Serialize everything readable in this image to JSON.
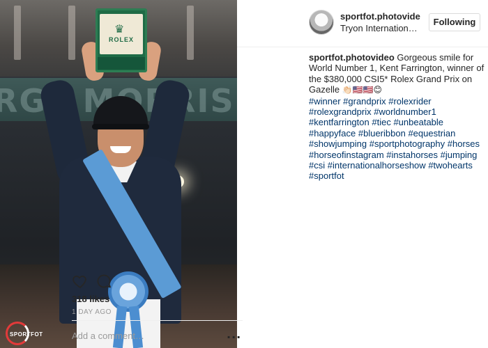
{
  "post": {
    "image_alt_brand": "ROLEX",
    "watermark": "SPORTFOT",
    "banner_text": "RGE MORRIS"
  },
  "header": {
    "username": "sportfot.photovide",
    "location": "Tryon International Equestrian Center",
    "follow_label": "Following"
  },
  "caption": {
    "user": "sportfot.photovideo",
    "text": "Gorgeous smile for World Number 1, Kent Farrington, winner of the $380,000 CSI5* Rolex Grand Prix on Gazelle",
    "emojis": "👏🏻🇺🇸🇺🇸😊",
    "hashtags": [
      "#winner",
      "#grandprix",
      "#rolexrider",
      "#rolexgrandprix",
      "#worldnumber1",
      "#kentfarrington",
      "#tiec",
      "#unbeatable",
      "#happyface",
      "#blueribbon",
      "#equestrian",
      "#showjumping",
      "#sportphotography",
      "#horses",
      "#horseofinstagram",
      "#instahorses",
      "#jumping",
      "#csi",
      "#internationalhorseshow",
      "#twohearts",
      "#sportfot"
    ]
  },
  "stats": {
    "likes": "318 likes",
    "time": "1 DAY AGO"
  },
  "comment": {
    "placeholder": "Add a comment…",
    "more": "···"
  },
  "colors": {
    "hashtag": "#003569",
    "text": "#262626",
    "muted": "#999999",
    "border": "#dbdbdb"
  }
}
